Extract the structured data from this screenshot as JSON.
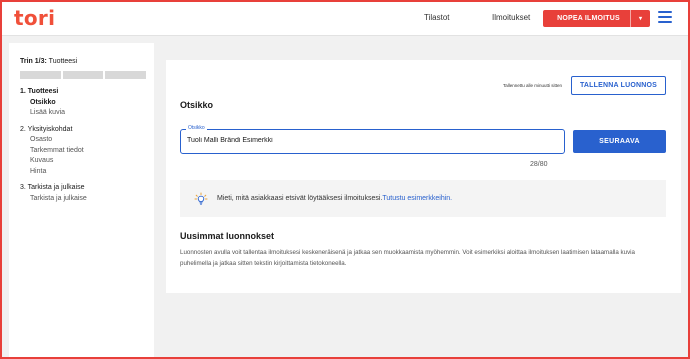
{
  "header": {
    "logo": "tori",
    "nav": [
      "Tilastot",
      "Ilmoitukset"
    ],
    "cta_label": "NOPEA ILMOITUS",
    "cta_caret": "▾"
  },
  "sidebar": {
    "step_prefix": "Trin 1/3:",
    "step_name": "Tuotteesi",
    "groups": [
      {
        "head": "1. Tuotteesi",
        "items": [
          "Otsikko",
          "Lisää kuvia"
        ]
      },
      {
        "head": "2. Yksityiskohdat",
        "items": [
          "Osasto",
          "Tarkemmat tiedot",
          "Kuvaus",
          "Hinta"
        ]
      },
      {
        "head": "3. Tarkista ja julkaise",
        "items": [
          "Tarkista ja julkaise"
        ]
      }
    ]
  },
  "main": {
    "saved_note": "Tallennettu alle minuutti sitten",
    "save_draft": "TALLENNA LUONNOS",
    "section_title": "Otsikko",
    "title_field": {
      "label": "Otsikko",
      "value": "Tuoli Malli Brändi Esimerkki"
    },
    "counter": "28/80",
    "next_button": "SEURAAVA",
    "tip_text": "Mieti, mitä asiakkaasi etsivät löytääksesi ilmoituksesi.",
    "tip_link": "Tutustu esimerkkeihin.",
    "drafts_title": "Uusimmat luonnokset",
    "drafts_text": "Luonnosten avulla voit tallentaa ilmoituksesi keskeneräisenä ja jatkaa sen muokkaamista myöhemmin. Voit esimerkiksi aloittaa ilmoituksen laatimisen lataamalla kuvia puhelimella ja jatkaa sitten tekstin kirjoittamista tietokoneella."
  },
  "colors": {
    "brand": "#e8403a",
    "accent": "#2961ce"
  },
  "icons": {
    "menu": "hamburger-menu-icon",
    "tip": "lightbulb-icon"
  }
}
